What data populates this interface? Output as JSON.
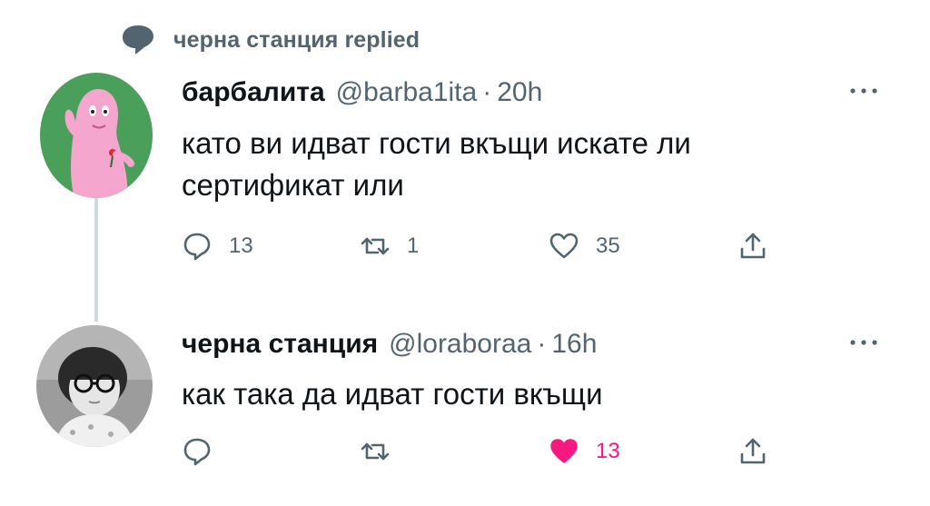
{
  "context": {
    "icon": "speech-bubble-icon",
    "text": "черна станция replied"
  },
  "tweets": [
    {
      "avatar": "barbapapa-avatar",
      "name": "барбалита",
      "handle": "@barba1ita",
      "sep": "·",
      "time": "20h",
      "text_line1": "като ви идват гости вкъщи искате ли",
      "text_line2": "сертификат или",
      "replies": "13",
      "retweets": "1",
      "likes": "35",
      "liked": false
    },
    {
      "avatar": "girl-with-glasses-avatar",
      "name": "черна станция",
      "handle": "@loraboraa",
      "sep": "·",
      "time": "16h",
      "text_line1": "как така да идват гости вкъщи",
      "replies": "",
      "retweets": "",
      "likes": "13",
      "liked": true,
      "like_color": "#f91880"
    }
  ],
  "colors": {
    "secondary_text": "#536471",
    "primary_text": "#0f1419",
    "like_pink": "#f91880",
    "thread_line": "#cfd9de"
  }
}
